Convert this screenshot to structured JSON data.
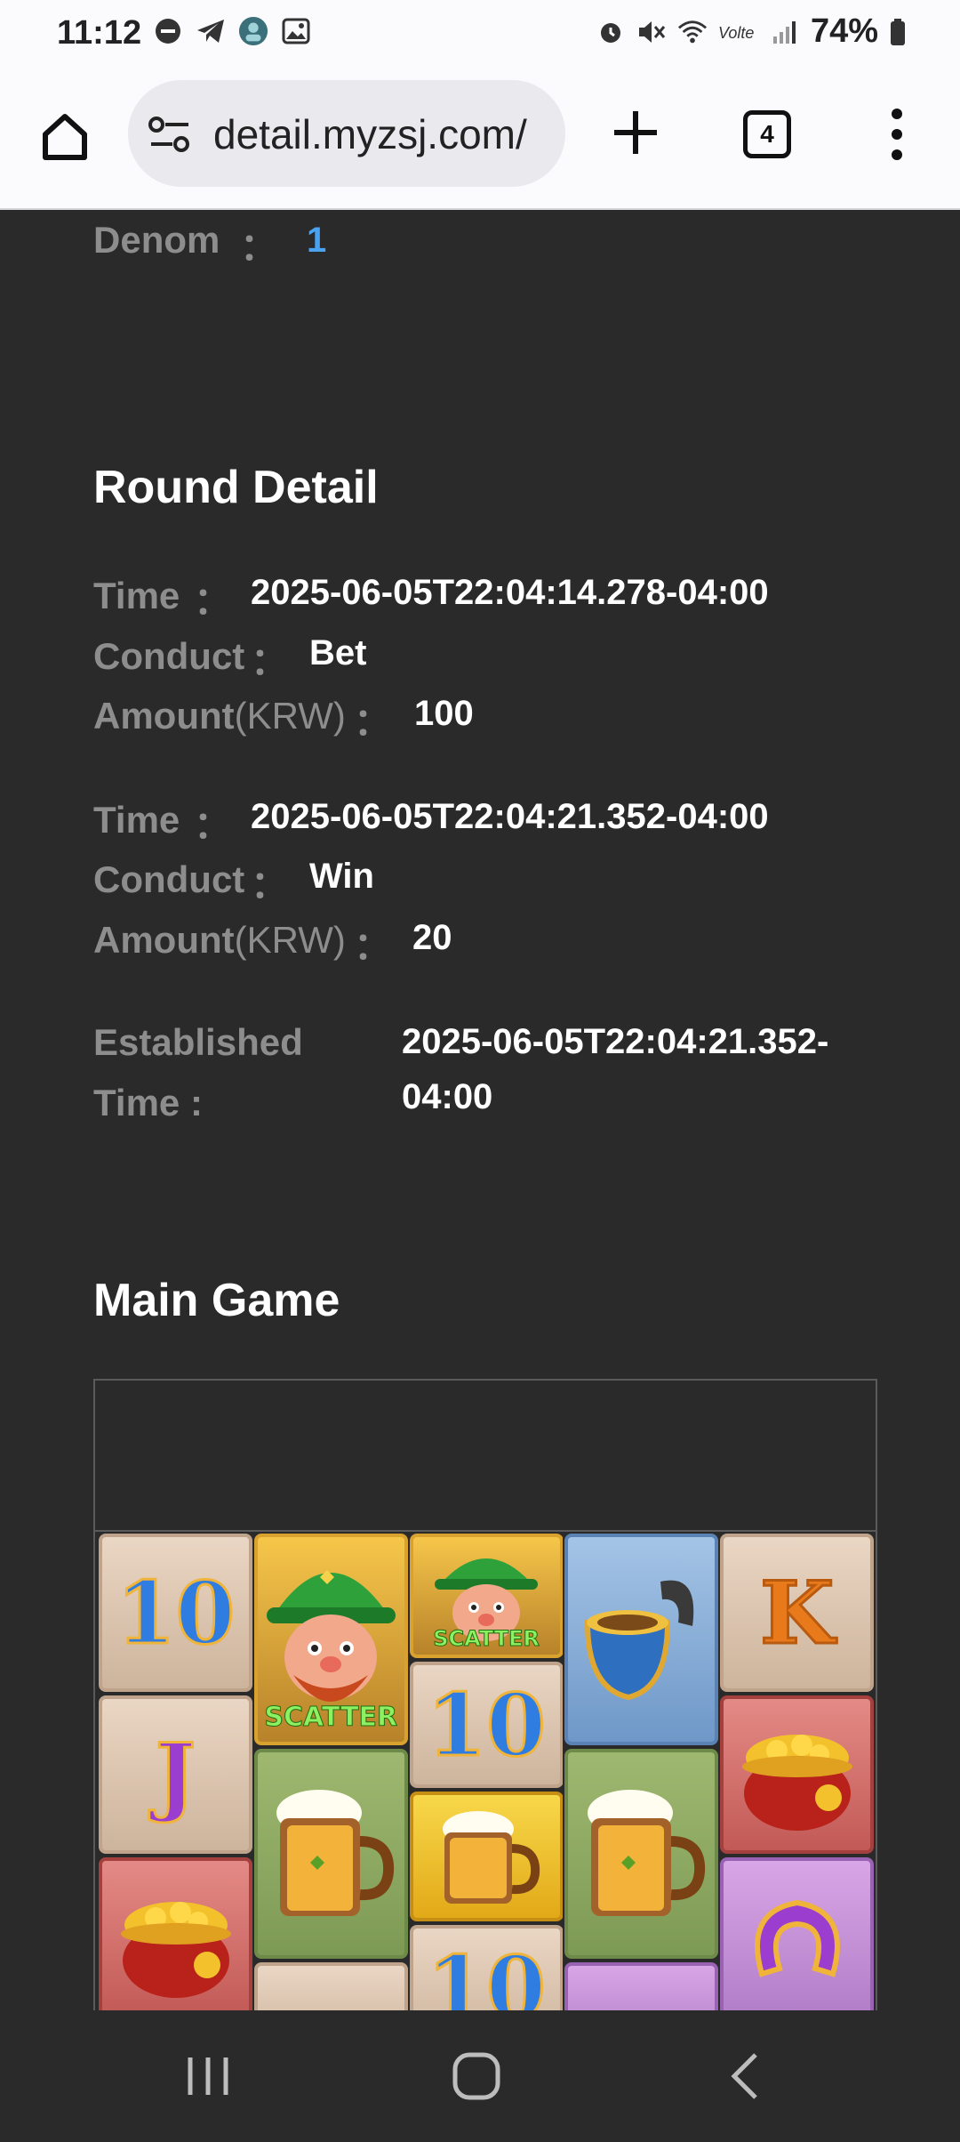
{
  "status_bar": {
    "time": "11:12",
    "battery": "74%",
    "icons_left": [
      "do-not-disturb-icon",
      "telegram-icon",
      "avatar-icon",
      "gallery-icon"
    ],
    "icons_right": [
      "alarm-icon",
      "mute-icon",
      "wifi-icon",
      "volte-icon",
      "signal-icon",
      "battery-icon"
    ]
  },
  "browser": {
    "url": "detail.myzsj.com/",
    "tab_count": "4"
  },
  "top_field": {
    "label": "Denom",
    "colon": "：",
    "value": "1"
  },
  "round_detail": {
    "title": "Round Detail",
    "entries": [
      {
        "time_label": "Time",
        "time_value": "2025-06-05T22:04:14.278-04:00",
        "conduct_label": "Conduct",
        "conduct_value": "Bet",
        "amount_label": "Amount",
        "amount_unit": "(KRW)",
        "amount_value": "100"
      },
      {
        "time_label": "Time",
        "time_value": "2025-06-05T22:04:21.352-04:00",
        "conduct_label": "Conduct",
        "conduct_value": "Win",
        "amount_label": "Amount",
        "amount_unit": "(KRW)",
        "amount_value": "20"
      }
    ],
    "colon": "：",
    "established_label_1": "Established",
    "established_label_2": "Time :",
    "established_value": "2025-06-05T22:04:21.352-04:00"
  },
  "main_game": {
    "title": "Main Game",
    "scatter_text": "SCATTER",
    "reels": [
      [
        "10",
        "J",
        "pot-of-gold"
      ],
      [
        "leprechaun-scatter",
        "beer-mug"
      ],
      [
        "leprechaun-scatter",
        "10",
        "beer-mug",
        "10"
      ],
      [
        "pipe",
        "beer-mug",
        "purple"
      ],
      [
        "K",
        "pot-of-gold",
        "horseshoe"
      ]
    ]
  },
  "nav": {
    "recents": "recents-icon",
    "home": "home-icon",
    "back": "back-icon"
  }
}
